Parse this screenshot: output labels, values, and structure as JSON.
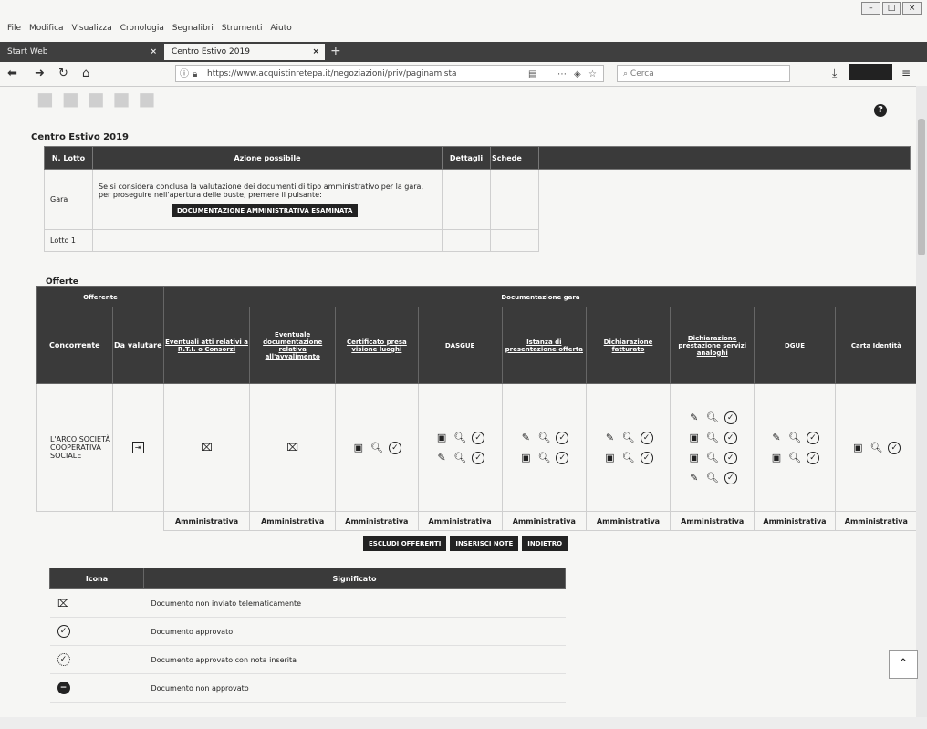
{
  "menu": [
    "File",
    "Modifica",
    "Visualizza",
    "Cronologia",
    "Segnalibri",
    "Strumenti",
    "Aiuto"
  ],
  "tabs": [
    {
      "label": "Start Web",
      "active": false
    },
    {
      "label": "Centro Estivo 2019",
      "active": true
    }
  ],
  "browser": {
    "url": "https://www.acquistinretepa.it/negoziazioni/priv/paginamista",
    "search_placeholder": "Cerca",
    "close_glyph": "×",
    "newtab_glyph": "+"
  },
  "help_glyph": "?",
  "page_title": "Centro Estivo 2019",
  "lotti_table": {
    "headers": [
      "N. Lotto",
      "Azione possibile",
      "Dettagli",
      "Schede"
    ],
    "rows": [
      {
        "lotto": "Gara",
        "azione": "Se si considera conclusa la valutazione dei documenti di tipo amministrativo per la gara, per proseguire nell'apertura delle buste, premere il pulsante:",
        "button": "DOCUMENTAZIONE AMMINISTRATIVA ESAMINATA"
      },
      {
        "lotto": "Lotto 1",
        "azione": "",
        "button": ""
      }
    ]
  },
  "offerte": {
    "label": "Offerte",
    "group_offerente": "Offerente",
    "group_doc": "Documentazione gara",
    "col_concorrente": "Concorrente",
    "col_da_valutare": "Da valutare",
    "doc_columns": [
      "Eventuali atti relativi a R.T.I. o Consorzi",
      "Eventuale documentazione relativa all'avvalimento",
      "Certificato presa visione luoghi",
      "DASGUE",
      "Istanza di presentazione offerta",
      "Dichiarazione fatturato",
      "Dichiarazione prestazione servizi analoghi",
      "DGUE",
      "Carta Identità"
    ],
    "concorrente": "L'ARCO SOCIETÀ COOPERATIVA SOCIALE",
    "footer_label": "Amministrativa"
  },
  "actions": [
    "ESCLUDI OFFERENTI",
    "INSERISCI NOTE",
    "INDIETRO"
  ],
  "legend": {
    "headers": [
      "Icona",
      "Significato"
    ],
    "rows": [
      {
        "icon": "not-sent-icon",
        "text": "Documento non inviato telematicamente"
      },
      {
        "icon": "approved-icon",
        "text": "Documento approvato"
      },
      {
        "icon": "approved-note-icon",
        "text": "Documento approvato con nota inserita"
      },
      {
        "icon": "not-approved-icon",
        "text": "Documento non approvato"
      }
    ]
  }
}
